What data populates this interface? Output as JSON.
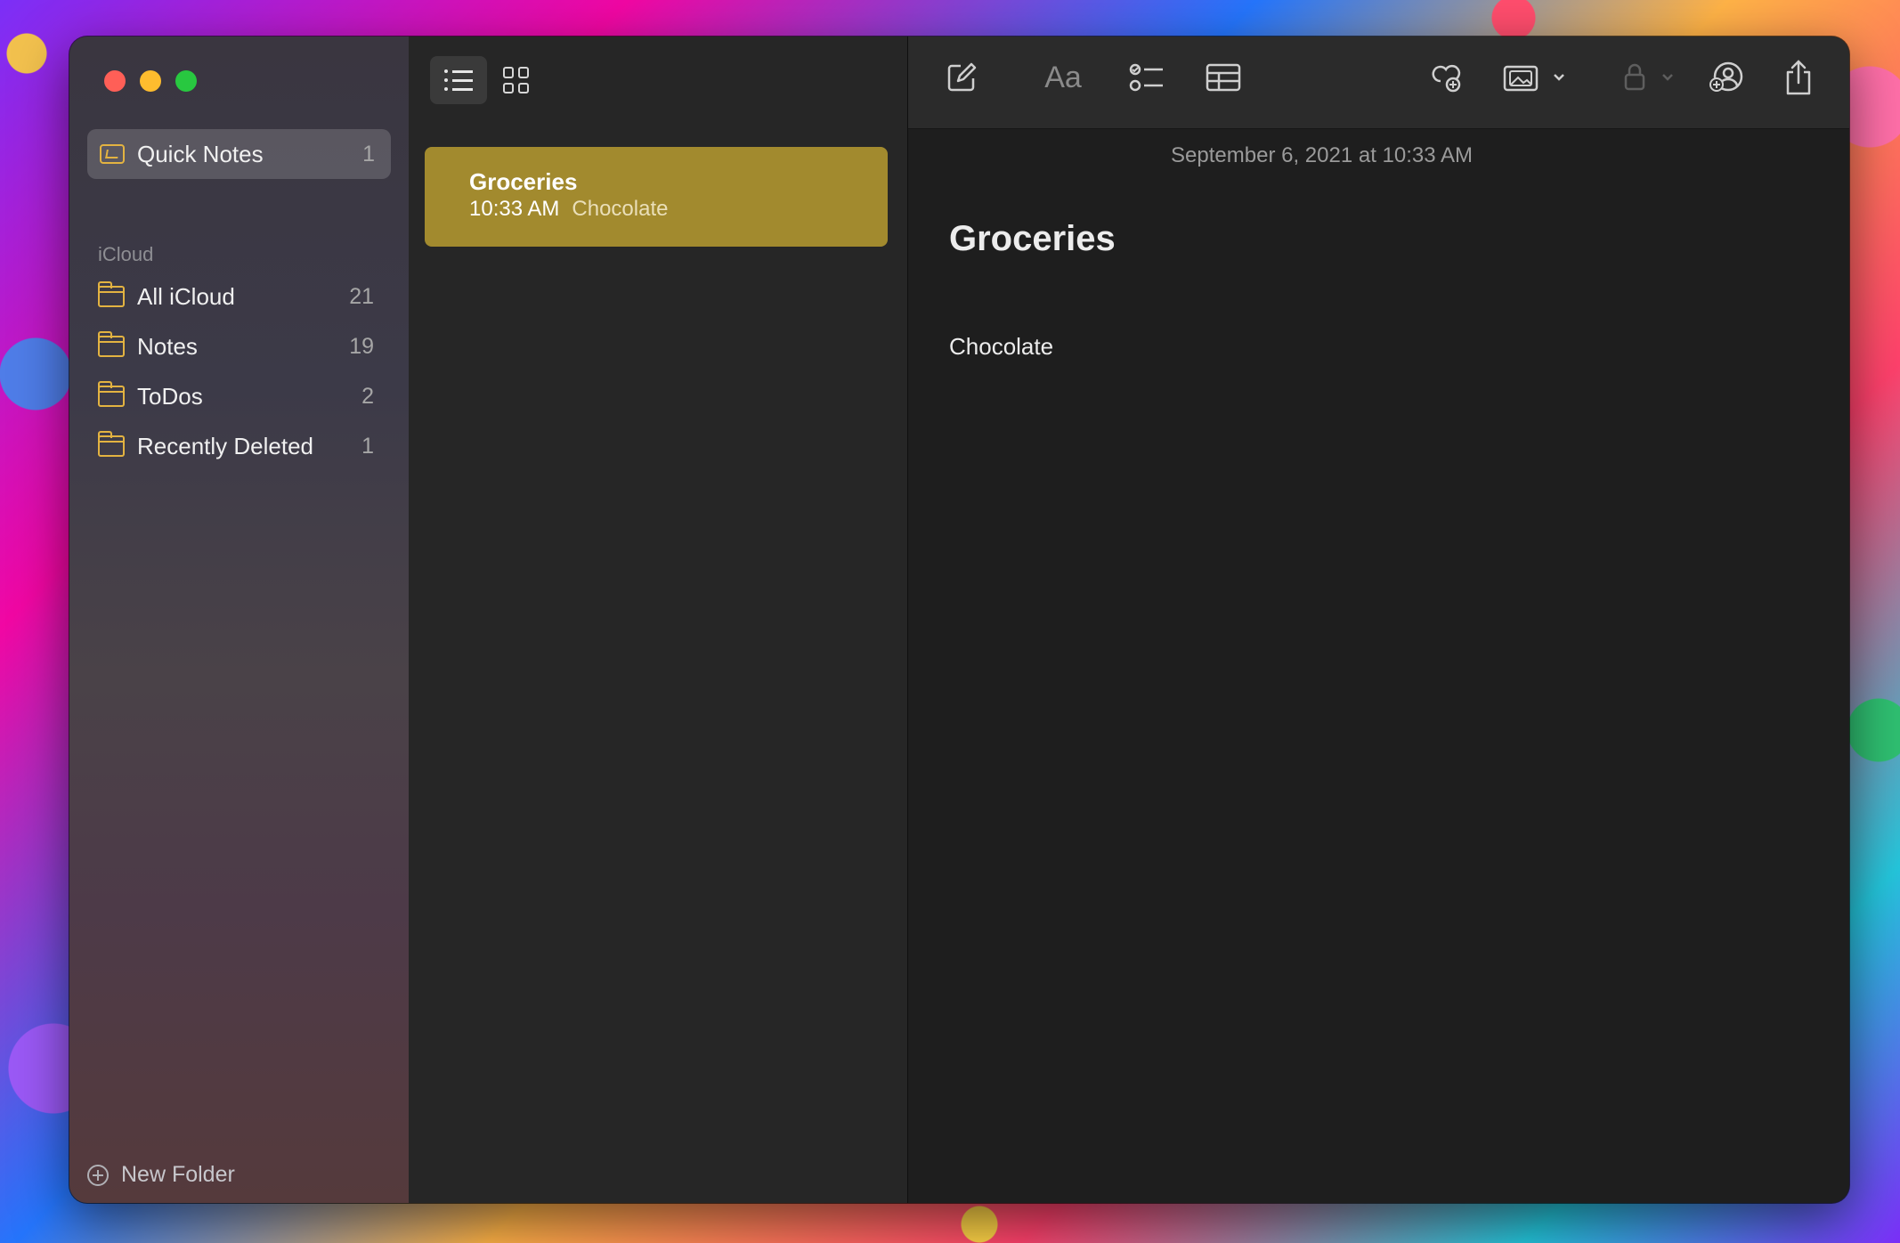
{
  "window": {
    "traffic_lights": [
      "close",
      "minimize",
      "zoom"
    ]
  },
  "sidebar": {
    "quick_notes": {
      "label": "Quick Notes",
      "count": "1"
    },
    "section_label": "iCloud",
    "folders": [
      {
        "label": "All iCloud",
        "count": "21"
      },
      {
        "label": "Notes",
        "count": "19"
      },
      {
        "label": "ToDos",
        "count": "2"
      },
      {
        "label": "Recently Deleted",
        "count": "1"
      }
    ],
    "new_folder_label": "New Folder"
  },
  "notelist": {
    "notes": [
      {
        "title": "Groceries",
        "time": "10:33 AM",
        "preview": "Chocolate"
      }
    ]
  },
  "toolbar": {
    "format_label": "Aa",
    "icons": [
      "compose-icon",
      "format-icon",
      "checklist-icon",
      "table-icon",
      "collaborate-icon",
      "media-icon",
      "lock-icon",
      "share-people-icon",
      "share-icon",
      "search-icon"
    ]
  },
  "editor": {
    "date_line": "September 6, 2021 at 10:33 AM",
    "title": "Groceries",
    "body": "Chocolate"
  },
  "colors": {
    "accent_folder": "#e3b341",
    "selected_note": "#a28a2e",
    "close": "#ff5f57",
    "minimize": "#febc2e",
    "zoom": "#28c840"
  }
}
